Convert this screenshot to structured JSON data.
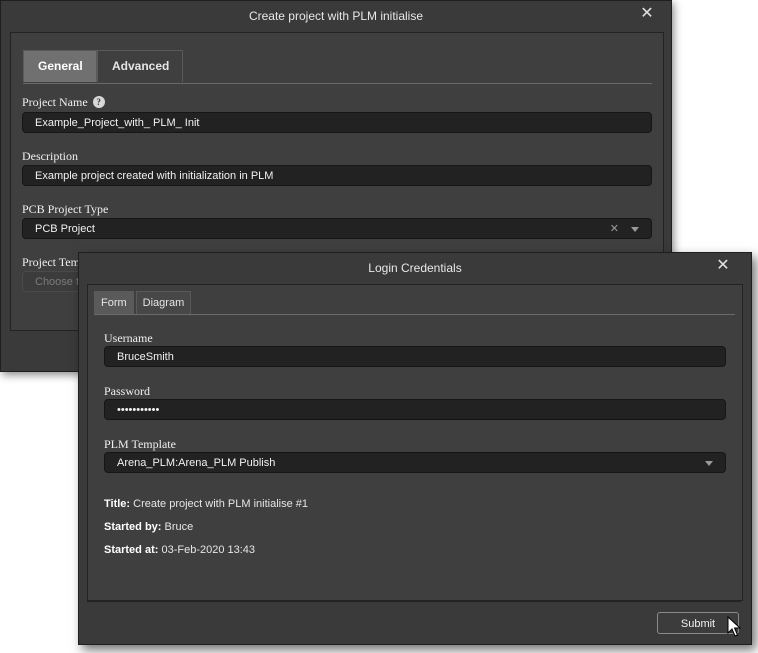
{
  "dialog_main": {
    "title": "Create project with PLM initialise",
    "tabs": [
      {
        "label": "General"
      },
      {
        "label": "Advanced"
      }
    ],
    "project_name": {
      "label": "Project Name",
      "value": "Example_Project_with_ PLM_ Init"
    },
    "description": {
      "label": "Description",
      "value": "Example project created with initialization in PLM"
    },
    "pcb_type": {
      "label": "PCB Project Type",
      "value": "PCB Project"
    },
    "template": {
      "label": "Project Templ",
      "placeholder": "Choose t"
    }
  },
  "dialog_login": {
    "title": "Login Credentials",
    "tabs": [
      {
        "label": "Form"
      },
      {
        "label": "Diagram"
      }
    ],
    "username": {
      "label": "Username",
      "value": "BruceSmith"
    },
    "password": {
      "label": "Password",
      "value": "•••••••••••"
    },
    "plm_template": {
      "label": "PLM Template",
      "value": "Arena_PLM:Arena_PLM Publish"
    },
    "info": {
      "title_label": "Title:",
      "title_value": "Create project with PLM initialise #1",
      "started_by_label": "Started by:",
      "started_by_value": "Bruce",
      "started_at_label": "Started at:",
      "started_at_value": "03-Feb-2020 13:43"
    },
    "submit_label": "Submit"
  },
  "icons": {
    "close": "close-icon",
    "help": "help-icon",
    "clear": "clear-icon",
    "dropdown": "chevron-down-icon",
    "cursor": "mouse-cursor-icon"
  }
}
